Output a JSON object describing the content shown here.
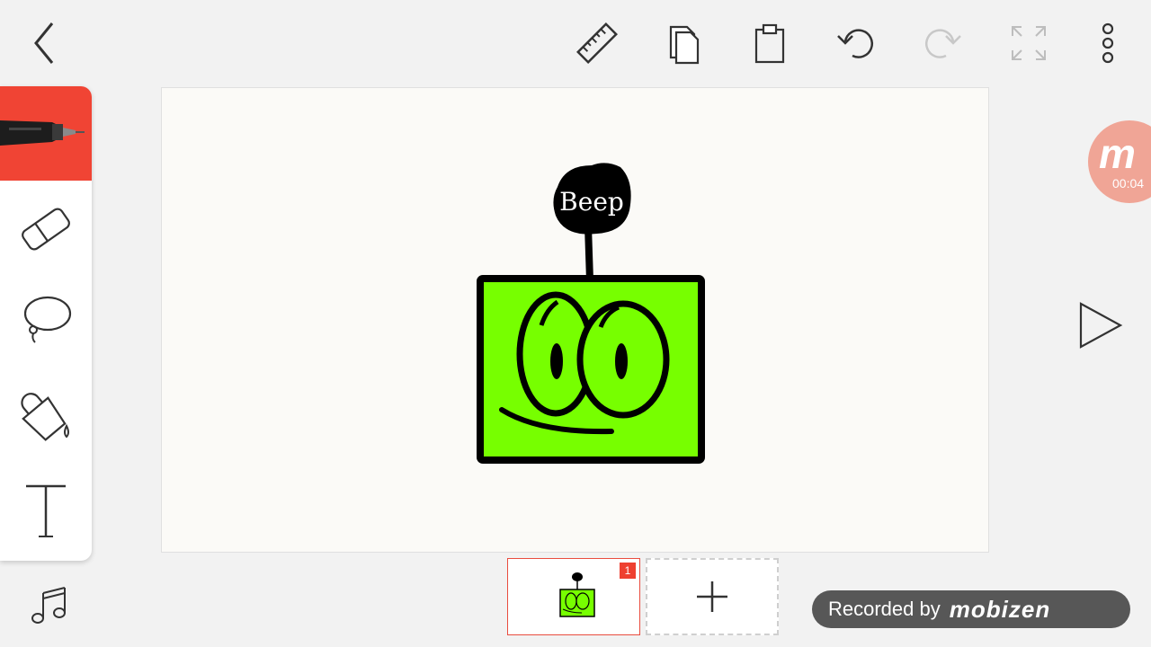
{
  "toolbar": {
    "back": "back-icon",
    "ruler": "ruler-icon",
    "copy": "copy-icon",
    "paste": "clipboard-icon",
    "undo": "undo-icon",
    "redo": "redo-icon",
    "fullscreen": "expand-icon",
    "more": "more-vertical-icon"
  },
  "tools": [
    {
      "name": "pen",
      "icon": "pen-icon",
      "selected": true
    },
    {
      "name": "eraser",
      "icon": "eraser-icon"
    },
    {
      "name": "lasso",
      "icon": "lasso-icon"
    },
    {
      "name": "fill",
      "icon": "paint-bucket-icon"
    },
    {
      "name": "text",
      "icon": "text-icon"
    }
  ],
  "music": {
    "icon": "music-note-icon"
  },
  "drawing": {
    "speech_text": "Beep",
    "body_color": "#77ff00",
    "outline_color": "#000000"
  },
  "timeline": {
    "frames": [
      {
        "number": "1"
      }
    ],
    "add_label": "+"
  },
  "play": {
    "icon": "play-icon"
  },
  "mobizen": {
    "logo": "m",
    "timer": "00:04",
    "recorded_by": "Recorded by",
    "brand": "mobizen"
  },
  "colors": {
    "accent": "#f04434",
    "canvas": "#fbfaf7",
    "background": "#f2f2f2"
  }
}
